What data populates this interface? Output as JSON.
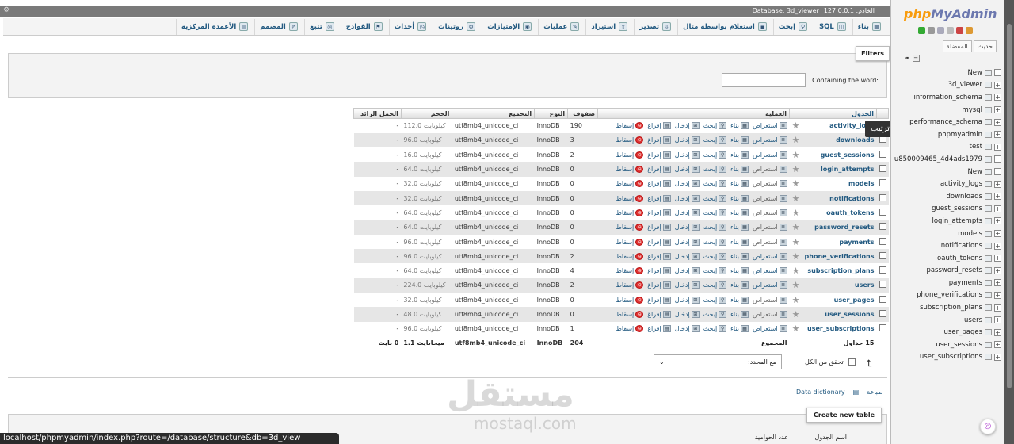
{
  "topbar": {
    "crumbs": [
      "الخادم: 127.0.0.1",
      "Database: 3d_viewer"
    ]
  },
  "tabs": [
    {
      "label": "بناء",
      "icon": "structure-icon"
    },
    {
      "label": "SQL",
      "icon": "sql-icon"
    },
    {
      "label": "إبحث",
      "icon": "search-icon"
    },
    {
      "label": "استعلام بواسطة مثال",
      "icon": "query-icon"
    },
    {
      "label": "تصدير",
      "icon": "export-icon"
    },
    {
      "label": "استيراد",
      "icon": "import-icon"
    },
    {
      "label": "عمليات",
      "icon": "operations-icon"
    },
    {
      "label": "الإمتيازات",
      "icon": "privileges-icon"
    },
    {
      "label": "روتينات",
      "icon": "routines-icon"
    },
    {
      "label": "أحداث",
      "icon": "events-icon"
    },
    {
      "label": "القوادح",
      "icon": "triggers-icon"
    },
    {
      "label": "تتبع",
      "icon": "tracking-icon"
    },
    {
      "label": "المصمم",
      "icon": "designer-icon"
    },
    {
      "label": "الأعمدة المركزية",
      "icon": "central-columns-icon"
    }
  ],
  "filters": {
    "legend": "Filters",
    "label": "Containing the word:",
    "value": ""
  },
  "table": {
    "headers": {
      "table": "الجدول",
      "action": "العملية",
      "rows": "صفوف",
      "type": "النوع",
      "collation": "التجميع",
      "size": "الحجم",
      "overhead": "الحمل الزائد"
    },
    "actions": {
      "browse": "استعراض",
      "structure": "بناء",
      "search": "إبحث",
      "insert": "إدخال",
      "empty": "إفراغ",
      "drop": "إسقاط"
    },
    "rows": [
      {
        "name": "activity_logs",
        "rows": "190",
        "engine": "InnoDB",
        "collation": "utf8mb4_unicode_ci",
        "size": "112.0 كيلوبايت",
        "overhead": "-"
      },
      {
        "name": "downloads",
        "rows": "3",
        "engine": "InnoDB",
        "collation": "utf8mb4_unicode_ci",
        "size": "96.0 كيلوبايت",
        "overhead": "-"
      },
      {
        "name": "guest_sessions",
        "rows": "2",
        "engine": "InnoDB",
        "collation": "utf8mb4_unicode_ci",
        "size": "16.0 كيلوبايت",
        "overhead": "-"
      },
      {
        "name": "login_attempts",
        "rows": "0",
        "engine": "InnoDB",
        "collation": "utf8mb4_unicode_ci",
        "size": "64.0 كيلوبايت",
        "overhead": "-"
      },
      {
        "name": "models",
        "rows": "0",
        "engine": "InnoDB",
        "collation": "utf8mb4_unicode_ci",
        "size": "32.0 كيلوبايت",
        "overhead": "-"
      },
      {
        "name": "notifications",
        "rows": "0",
        "engine": "InnoDB",
        "collation": "utf8mb4_unicode_ci",
        "size": "32.0 كيلوبايت",
        "overhead": "-"
      },
      {
        "name": "oauth_tokens",
        "rows": "0",
        "engine": "InnoDB",
        "collation": "utf8mb4_unicode_ci",
        "size": "64.0 كيلوبايت",
        "overhead": "-"
      },
      {
        "name": "password_resets",
        "rows": "0",
        "engine": "InnoDB",
        "collation": "utf8mb4_unicode_ci",
        "size": "64.0 كيلوبايت",
        "overhead": "-"
      },
      {
        "name": "payments",
        "rows": "0",
        "engine": "InnoDB",
        "collation": "utf8mb4_unicode_ci",
        "size": "96.0 كيلوبايت",
        "overhead": "-"
      },
      {
        "name": "phone_verifications",
        "rows": "2",
        "engine": "InnoDB",
        "collation": "utf8mb4_unicode_ci",
        "size": "96.0 كيلوبايت",
        "overhead": "-"
      },
      {
        "name": "subscription_plans",
        "rows": "4",
        "engine": "InnoDB",
        "collation": "utf8mb4_unicode_ci",
        "size": "64.0 كيلوبايت",
        "overhead": "-"
      },
      {
        "name": "users",
        "rows": "2",
        "engine": "InnoDB",
        "collation": "utf8mb4_unicode_ci",
        "size": "224.0 كيلوبايت",
        "overhead": "-"
      },
      {
        "name": "user_pages",
        "rows": "0",
        "engine": "InnoDB",
        "collation": "utf8mb4_unicode_ci",
        "size": "32.0 كيلوبايت",
        "overhead": "-"
      },
      {
        "name": "user_sessions",
        "rows": "0",
        "engine": "InnoDB",
        "collation": "utf8mb4_unicode_ci",
        "size": "48.0 كيلوبايت",
        "overhead": "-"
      },
      {
        "name": "user_subscriptions",
        "rows": "1",
        "engine": "InnoDB",
        "collation": "utf8mb4_unicode_ci",
        "size": "96.0 كيلوبايت",
        "overhead": "-"
      }
    ],
    "total": {
      "tables": "15 جداول",
      "label": "المجموع",
      "rows": "204",
      "engine": "InnoDB",
      "collation": "utf8mb4_unicode_ci",
      "size": "1.1 ميجابايت",
      "overhead": "0 بايت"
    }
  },
  "tooltip": "ترتيب",
  "bulk": {
    "check_all": "تحقق من الكل",
    "with_selected": "مع المحدد:"
  },
  "links": {
    "print": "طباعة",
    "dictionary": "Data dictionary"
  },
  "new_table": "Create new table",
  "bottom": {
    "table_name": "اسم الجدول",
    "columns": "عدد الحواميد"
  },
  "status_url": "localhost/phpmyadmin/index.php?route=/database/structure&db=3d_view",
  "watermark": {
    "ar": "مستقل",
    "en": "mostaql.com"
  },
  "sidebar": {
    "logo_a": "php",
    "logo_b": "MyAdmin",
    "tabs": [
      "حديث",
      "المفضلة"
    ],
    "tree": [
      "New",
      "3d_viewer",
      "information_schema",
      "mysql",
      "performance_schema",
      "phpmyadmin",
      "test",
      "u850009465_4d4ads1979"
    ],
    "subtree": [
      "New",
      "activity_logs",
      "downloads",
      "guest_sessions",
      "login_attempts",
      "models",
      "notifications",
      "oauth_tokens",
      "password_resets",
      "payments",
      "phone_verifications",
      "subscription_plans",
      "users",
      "user_pages",
      "user_sessions",
      "user_subscriptions"
    ]
  }
}
